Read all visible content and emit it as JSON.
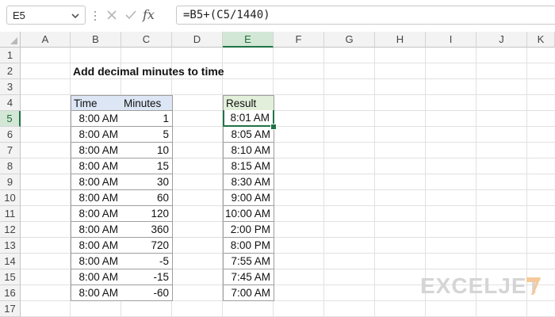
{
  "formula_bar": {
    "name_box": "E5",
    "fx": "fx",
    "formula": "=B5+(C5/1440)"
  },
  "columns": [
    "A",
    "B",
    "C",
    "D",
    "E",
    "F",
    "G",
    "H",
    "I",
    "J",
    "K"
  ],
  "rows": [
    "1",
    "2",
    "3",
    "4",
    "5",
    "6",
    "7",
    "8",
    "9",
    "10",
    "11",
    "12",
    "13",
    "14",
    "15",
    "16",
    "17"
  ],
  "sheet": {
    "title": "Add decimal minutes to time",
    "headers": {
      "time": "Time",
      "minutes": "Minutes",
      "result": "Result"
    },
    "data": [
      {
        "time": "8:00 AM",
        "minutes": "1",
        "result": "8:01 AM"
      },
      {
        "time": "8:00 AM",
        "minutes": "5",
        "result": "8:05 AM"
      },
      {
        "time": "8:00 AM",
        "minutes": "10",
        "result": "8:10 AM"
      },
      {
        "time": "8:00 AM",
        "minutes": "15",
        "result": "8:15 AM"
      },
      {
        "time": "8:00 AM",
        "minutes": "30",
        "result": "8:30 AM"
      },
      {
        "time": "8:00 AM",
        "minutes": "60",
        "result": "9:00 AM"
      },
      {
        "time": "8:00 AM",
        "minutes": "120",
        "result": "10:00 AM"
      },
      {
        "time": "8:00 AM",
        "minutes": "360",
        "result": "2:00 PM"
      },
      {
        "time": "8:00 AM",
        "minutes": "720",
        "result": "8:00 PM"
      },
      {
        "time": "8:00 AM",
        "minutes": "-5",
        "result": "7:55 AM"
      },
      {
        "time": "8:00 AM",
        "minutes": "-15",
        "result": "7:45 AM"
      },
      {
        "time": "8:00 AM",
        "minutes": "-60",
        "result": "7:00 AM"
      }
    ]
  },
  "selection": {
    "column": "E",
    "row": "5"
  },
  "watermark": "EXCELJET",
  "colors": {
    "accent": "#217346",
    "header_blue": "#dce6f4",
    "header_green": "#e2efda"
  }
}
